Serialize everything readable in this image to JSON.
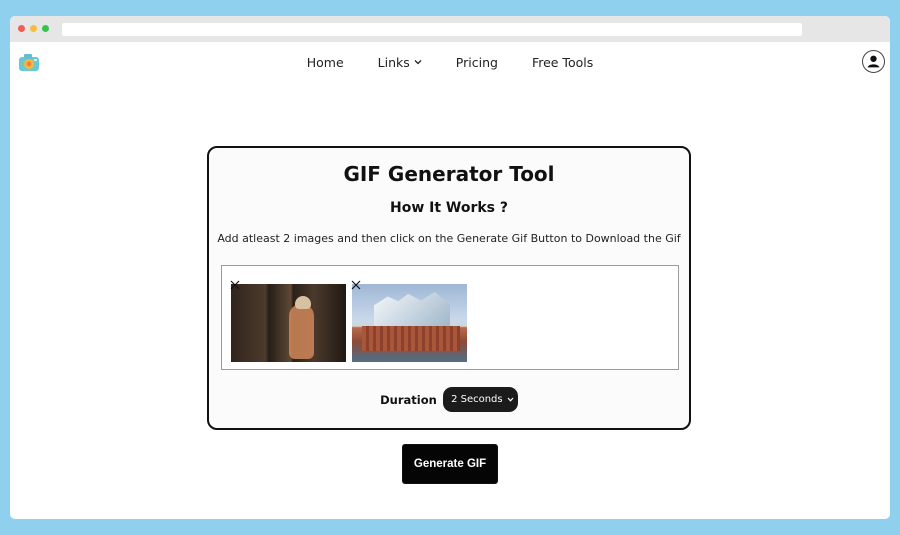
{
  "navigation": {
    "items": [
      {
        "label": "Home"
      },
      {
        "label": "Links"
      },
      {
        "label": "Pricing"
      },
      {
        "label": "Free Tools"
      }
    ]
  },
  "tool": {
    "title": "GIF Generator Tool",
    "subtitle": "How It Works ?",
    "instructions": "Add atleast 2 images and then click on the Generate Gif Button to Download the Gif",
    "duration_label": "Duration",
    "duration_selected": "2 Seconds",
    "generate_button": "Generate GIF"
  },
  "icons": {
    "logo": "camera-logo-icon",
    "links_dropdown": "chevron-down-icon",
    "account": "user-account-icon",
    "remove_image": "close-icon",
    "duration_dropdown": "chevron-down-icon"
  },
  "colors": {
    "page_background": "#8fd0ee",
    "toolbar": "#e6e6e6",
    "card_border": "#111111",
    "button_background": "#050505",
    "button_text": "#ffffff"
  }
}
